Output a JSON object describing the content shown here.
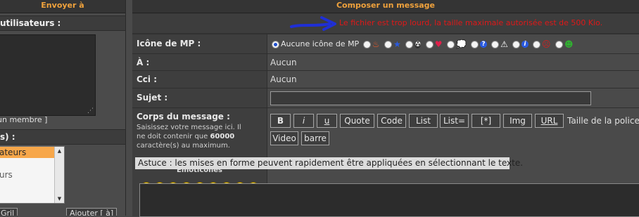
{
  "left": {
    "header": "Envoyer à",
    "users_label": "utilisateurs :",
    "add_member_label": "un membre ]",
    "groups_label": "s) :",
    "groups": [
      "ateurs",
      "",
      "urs",
      ""
    ],
    "btn1": "Gril",
    "btn2": "Ajouter [ à]"
  },
  "right": {
    "header": "Composer un message",
    "error": "Le fichier est trop lourd, la taille maximale autorisée est de 500 Kio.",
    "icon_label": "Icône de MP :",
    "no_icon": "Aucune icône de MP",
    "icons": [
      "flame-icon",
      "star-icon",
      "radioactive-icon",
      "heart-icon",
      "thought-bubble-icon",
      "question-icon",
      "warning-icon",
      "info-icon",
      "mad-icon",
      "alien-icon"
    ],
    "to_label": "À :",
    "to_value": "Aucun",
    "bcc_label": "Cci :",
    "bcc_value": "Aucun",
    "subject_label": "Sujet :",
    "subject_value": "",
    "body_label": "Corps du message :",
    "body_help_1": "Saisissez votre message ici. Il",
    "body_help_2a": "ne doit contenir que ",
    "body_help_2b": "60000",
    "body_help_3": "caractère(s) au maximum.",
    "smilies_label": "Émoticônes",
    "toolbar": {
      "bold": "B",
      "italic": "i",
      "underline": "u",
      "quote": "Quote",
      "code": "Code",
      "list": "List",
      "list_eq": "List=",
      "star": "[*]",
      "img": "Img",
      "url": "URL",
      "font_size": "Taille de la police",
      "video": "Video",
      "strike": "barre"
    },
    "hint": "Astuce : les mises en forme peuvent rapidement être appliquées en sélectionnant le texte."
  },
  "colors": {
    "accent": "#f0a23c",
    "error": "#e01818",
    "arrow": "#1f2fd6"
  }
}
